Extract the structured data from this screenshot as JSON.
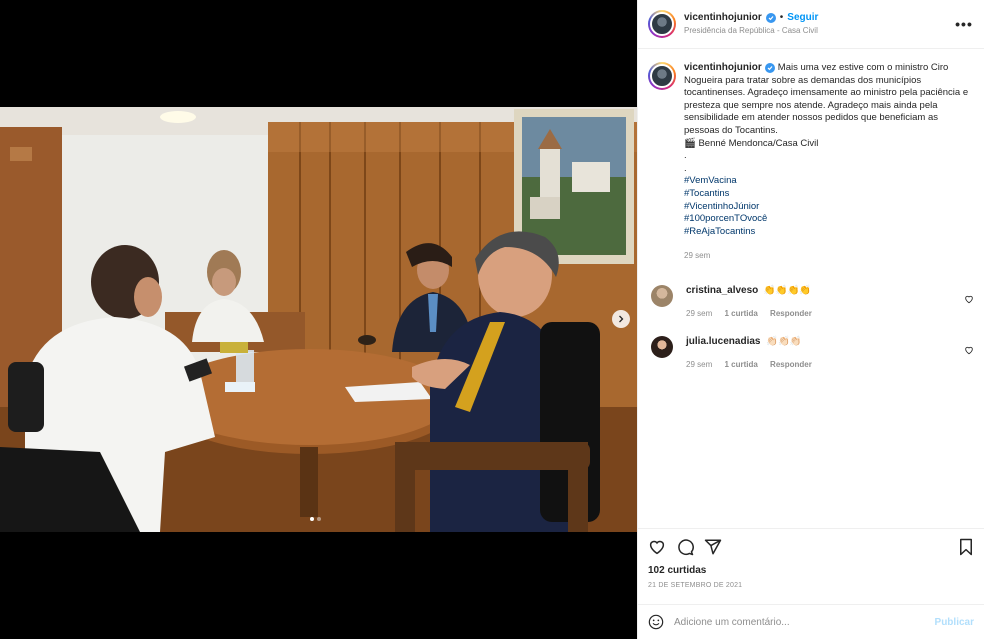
{
  "post": {
    "username": "vicentinhojunior",
    "follow_label": "Seguir",
    "separator": "•",
    "location": "Presidência da República - Casa Civil",
    "more_label": "•••"
  },
  "caption": {
    "username": "vicentinhojunior",
    "text": "Mais uma vez estive com o ministro Ciro Nogueira para tratar sobre as demandas dos municípios tocantinenses. Agradeço imensamente ao ministro pela paciência e presteza que sempre nos atende. Agradeço mais ainda pela sensibilidade em atender nossos pedidos que beneficiam as pessoas do Tocantins.",
    "credit": "🎬 Benné Mendonca/Casa Civil",
    "dot1": ".",
    "dot2": ".",
    "hashtags": [
      "#VemVacina",
      "#Tocantins",
      "#VicentinhoJúnior",
      "#100porcenTOvocê",
      "#ReAjaTocantins"
    ],
    "time": "29 sem"
  },
  "comments": [
    {
      "username": "cristina_alveso",
      "text": "👏👏👏👏",
      "time": "29 sem",
      "likes": "1 curtida",
      "reply": "Responder"
    },
    {
      "username": "julia.lucenadias",
      "text": "👏🏻👏🏻👏🏻",
      "time": "29 sem",
      "likes": "1 curtida",
      "reply": "Responder"
    }
  ],
  "stats": {
    "likes": "102 curtidas",
    "date": "21 DE SETEMBRO DE 2021"
  },
  "comment_box": {
    "placeholder": "Adicione um comentário...",
    "publish": "Publicar"
  },
  "carousel": {
    "current": 1,
    "total": 2
  },
  "colors": {
    "link_blue": "#0095f6",
    "hashtag_blue": "#00376b",
    "muted_gray": "#8e8e8e",
    "publish_disabled": "#b2dffc"
  }
}
